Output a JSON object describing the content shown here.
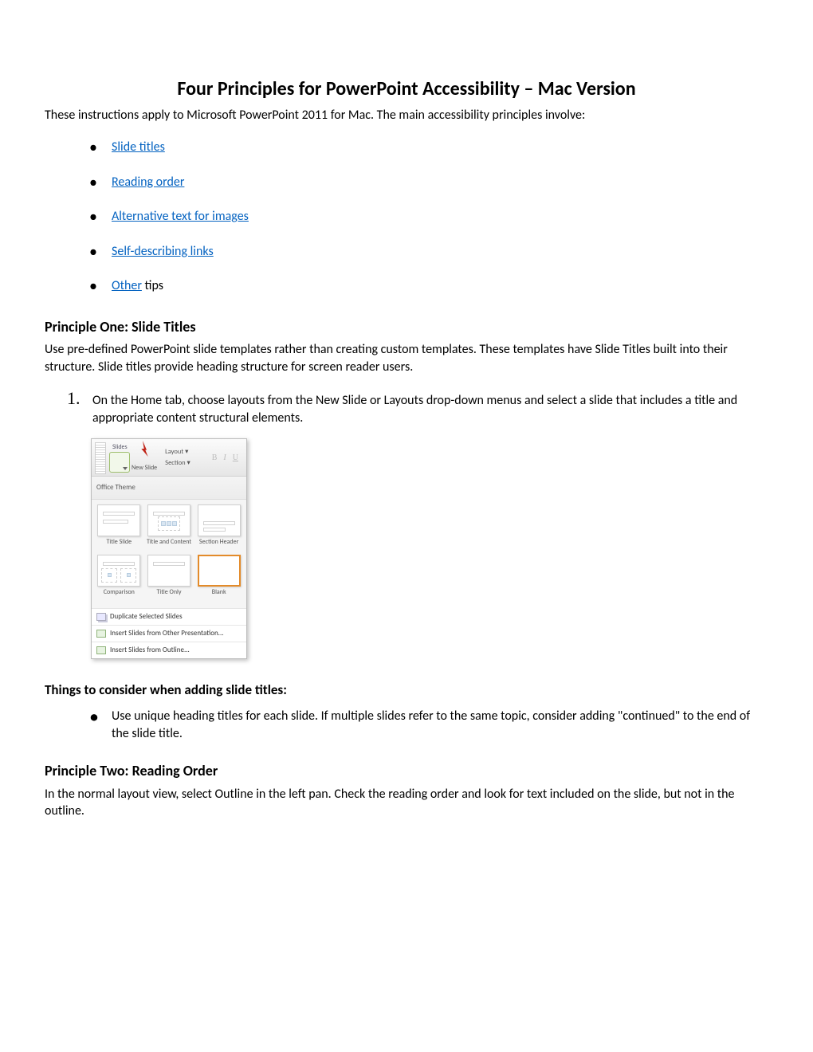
{
  "title": "Four Principles for PowerPoint Accessibility – Mac Version",
  "intro": "These instructions apply to Microsoft PowerPoint 2011 for Mac. The main accessibility principles involve:",
  "toc": [
    {
      "text": "Slide titles",
      "suffix": ""
    },
    {
      "text": "Reading order",
      "suffix": ""
    },
    {
      "text": "Alternative text for images",
      "suffix": ""
    },
    {
      "text": "Self-describing links",
      "suffix": ""
    },
    {
      "text": "Other",
      "suffix": " tips"
    }
  ],
  "p1": {
    "heading": "Principle One: Slide Titles",
    "body": "Use pre-defined PowerPoint slide templates rather than creating custom templates. These templates have Slide Titles built into their structure. Slide titles provide heading structure for screen reader users.",
    "step_num": "1.",
    "step_text": "On the Home tab, choose layouts from the New Slide or Layouts drop-down menus and select a slide that includes a title and appropriate content structural elements."
  },
  "screenshot": {
    "slides_label": "Slides",
    "new_slide": "New Slide",
    "layout": "Layout",
    "section": "Section",
    "theme_label": "Office Theme",
    "layouts": [
      "Title Slide",
      "Title and Content",
      "Section Header",
      "Comparison",
      "Title Only",
      "Blank"
    ],
    "menu": [
      "Duplicate Selected Slides",
      "Insert Slides from Other Presentation...",
      "Insert Slides from Outline..."
    ]
  },
  "consider_heading": "Things to consider when adding slide titles:",
  "consider_item": "Use unique heading titles for each slide. If multiple slides refer to the same topic, consider adding \"continued\" to the end of the slide title.",
  "p2": {
    "heading": "Principle Two: Reading Order",
    "body": "In the normal layout view, select Outline in the left pan. Check the reading order and look for text included on the slide, but not in the outline."
  }
}
